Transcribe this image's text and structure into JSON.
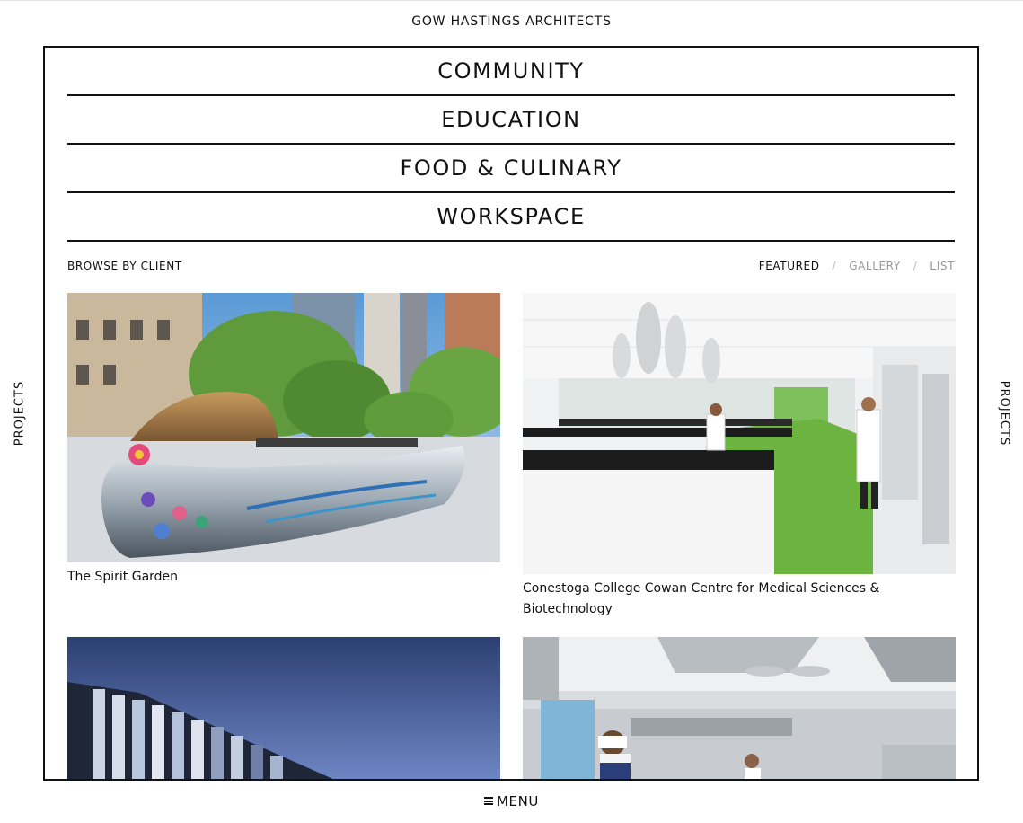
{
  "site": {
    "title": "GOW HASTINGS ARCHITECTS"
  },
  "categories": [
    "COMMUNITY",
    "EDUCATION",
    "FOOD & CULINARY",
    "WORKSPACE"
  ],
  "toolbar": {
    "browse_label": "BROWSE BY CLIENT",
    "views": [
      {
        "label": "FEATURED",
        "active": true
      },
      {
        "label": "GALLERY",
        "active": false
      },
      {
        "label": "LIST",
        "active": false
      }
    ],
    "separator": "/"
  },
  "projects": [
    {
      "title": "The Spirit Garden"
    },
    {
      "title": "Conestoga College Cowan Centre for Medical Sciences & Biotechnology"
    },
    {
      "title": ""
    },
    {
      "title": ""
    }
  ],
  "side_nav": {
    "left_label": "PROJECTS",
    "right_label": "PROJECTS"
  },
  "footer": {
    "menu_label": "MENU"
  },
  "colors": {
    "accent": "#111111",
    "muted": "#999999",
    "lab_floor": "#6db33f"
  }
}
